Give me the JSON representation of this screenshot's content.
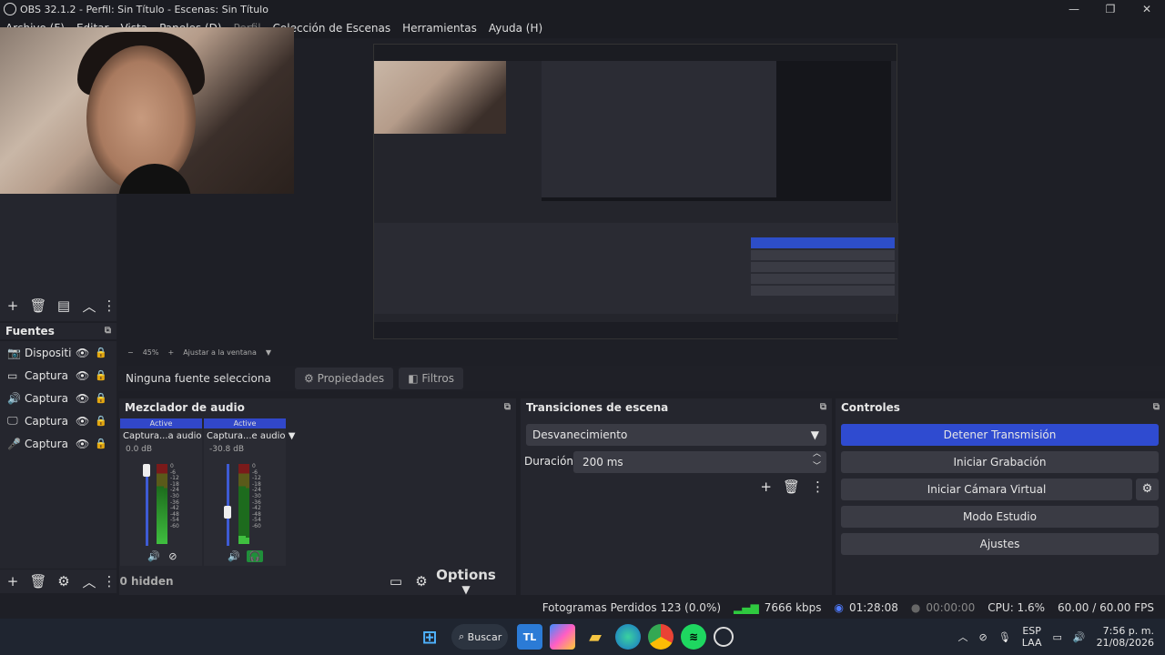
{
  "window": {
    "title": "OBS 32.1.2 - Perfil: Sin Título - Escenas: Sin Título"
  },
  "menu": [
    {
      "label": "Archivo (F)"
    },
    {
      "label": "Editar"
    },
    {
      "label": "Vista"
    },
    {
      "label": "Paneles (D)"
    },
    {
      "label": "Perfil",
      "dim": true
    },
    {
      "label": "Colección de Escenas"
    },
    {
      "label": "Herramientas"
    },
    {
      "label": "Ayuda (H)"
    }
  ],
  "zoom": {
    "level": "45%",
    "fit_label": "Ajustar a la ventana"
  },
  "sources": {
    "title": "Fuentes",
    "items": [
      {
        "name": "Dispositiv",
        "icon": "camera-icon"
      },
      {
        "name": "Captura d",
        "icon": "window-icon"
      },
      {
        "name": "Captura d",
        "icon": "speaker-icon"
      },
      {
        "name": "Captura d",
        "icon": "monitor-icon"
      },
      {
        "name": "Captura d",
        "icon": "mic-icon"
      }
    ]
  },
  "properties_bar": {
    "no_selection": "Ninguna fuente selecciona",
    "properties": "Propiedades",
    "filters": "Filtros"
  },
  "mixer": {
    "title": "Mezclador de audio",
    "channels": [
      {
        "status": "Active",
        "name": "Captura...a audio",
        "db": "0.0 dB",
        "level": 0.25
      },
      {
        "status": "Active",
        "name": "Captura...e audio",
        "db": "-30.8 dB",
        "level": 0.45
      }
    ],
    "ticks": [
      "0",
      "-6",
      "-12",
      "-18",
      "-24",
      "-30",
      "-36",
      "-42",
      "-48",
      "-54",
      "-60"
    ],
    "footer": {
      "hidden": "0 hidden",
      "options": "Options"
    }
  },
  "transitions": {
    "title": "Transiciones de escena",
    "selected": "Desvanecimiento",
    "duration_label": "Duración",
    "duration": "200 ms"
  },
  "controls": {
    "title": "Controles",
    "stream": "Detener Transmisión",
    "record": "Iniciar Grabación",
    "virtual_cam": "Iniciar Cámara Virtual",
    "studio": "Modo Estudio",
    "settings": "Ajustes"
  },
  "status": {
    "dropped": "Fotogramas Perdidos 123 (0.0%)",
    "bitrate": "7666 kbps",
    "stream_time": "01:28:08",
    "rec_time": "00:00:00",
    "cpu": "CPU: 1.6%",
    "fps": "60.00 / 60.00 FPS"
  },
  "taskbar": {
    "search": "Buscar",
    "lang1": "ESP",
    "lang2": "LAA",
    "time": "7:56 p. m.",
    "date": "21/08/2026"
  },
  "colors": {
    "accent": "#2f4bd0",
    "panel": "#25262e",
    "bg": "#1e1f26"
  }
}
